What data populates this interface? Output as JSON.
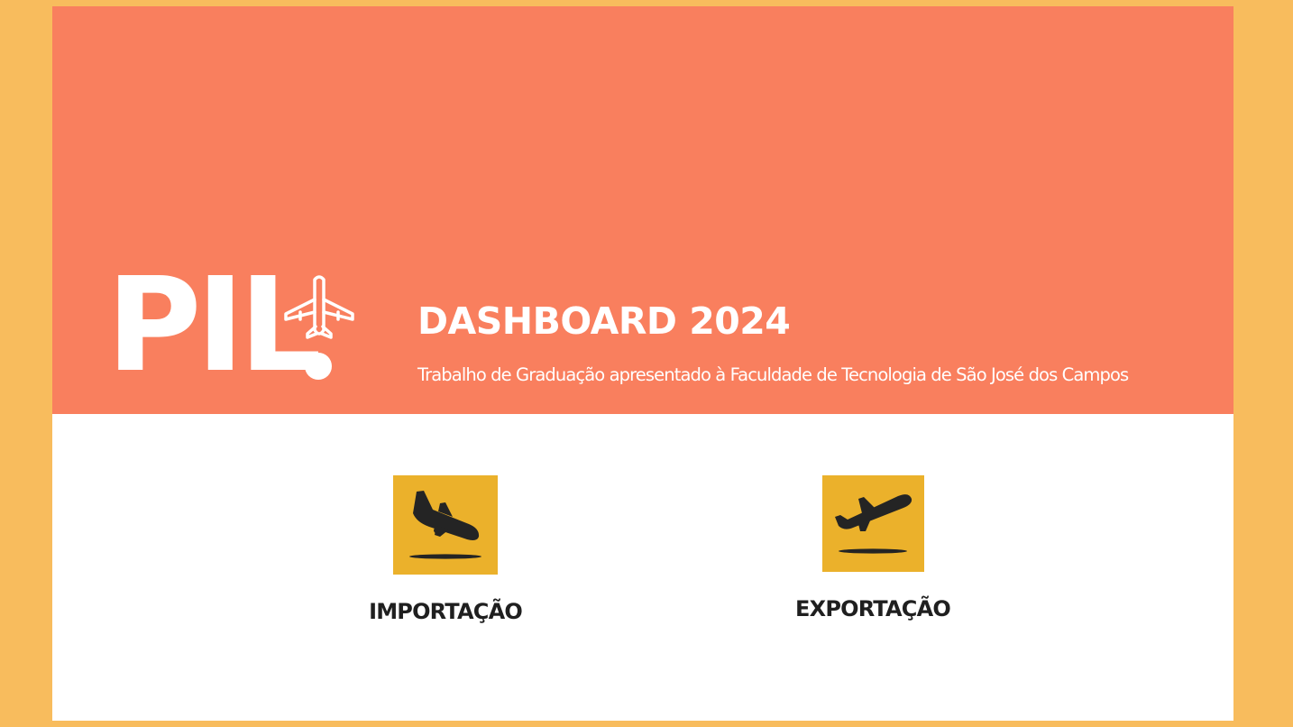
{
  "header": {
    "logo_text": "PIL",
    "title": "DASHBOARD 2024",
    "subtitle": "Trabalho de Graduação apresentado à Faculdade de Tecnologia de São José dos Campos"
  },
  "tiles": [
    {
      "label": "IMPORTAÇÃO",
      "icon": "plane-landing-icon"
    },
    {
      "label": "EXPORTAÇÃO",
      "icon": "plane-takeoff-icon"
    }
  ],
  "colors": {
    "page_background": "#F8BC5D",
    "hero_background": "#F97F5E",
    "card_background": "#FFFFFF",
    "tile_background": "#EBB12B",
    "icon_color": "#242424",
    "text_dark": "#1F1F1F",
    "text_light": "#FFFFFF"
  }
}
